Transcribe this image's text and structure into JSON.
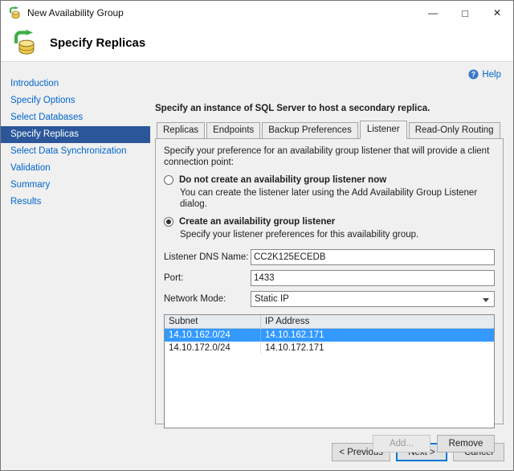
{
  "window": {
    "title": "New Availability Group",
    "controls": {
      "minimize": "—",
      "maximize": "□",
      "close": "✕"
    }
  },
  "header": {
    "title": "Specify Replicas"
  },
  "sidebar": {
    "items": [
      {
        "label": "Introduction",
        "selected": false
      },
      {
        "label": "Specify Options",
        "selected": false
      },
      {
        "label": "Select Databases",
        "selected": false
      },
      {
        "label": "Specify Replicas",
        "selected": true
      },
      {
        "label": "Select Data Synchronization",
        "selected": false
      },
      {
        "label": "Validation",
        "selected": false
      },
      {
        "label": "Summary",
        "selected": false
      },
      {
        "label": "Results",
        "selected": false
      }
    ]
  },
  "content": {
    "help_label": "Help",
    "instruction": "Specify an instance of SQL Server to host a secondary replica.",
    "tabs": [
      {
        "label": "Replicas",
        "selected": false
      },
      {
        "label": "Endpoints",
        "selected": false
      },
      {
        "label": "Backup Preferences",
        "selected": false
      },
      {
        "label": "Listener",
        "selected": true
      },
      {
        "label": "Read-Only Routing",
        "selected": false
      }
    ],
    "listener": {
      "intro": "Specify your preference for an availability group listener that will provide a client connection point:",
      "radio_no": {
        "label": "Do not create an availability group listener now",
        "desc": "You can create the listener later using the Add Availability Group Listener dialog.",
        "checked": false
      },
      "radio_yes": {
        "label": "Create an availability group listener",
        "desc": "Specify your listener preferences for this availability group.",
        "checked": true
      },
      "fields": {
        "dns_label": "Listener DNS Name:",
        "dns_value": "CC2K125ECEDB",
        "port_label": "Port:",
        "port_value": "1433",
        "network_mode_label": "Network Mode:",
        "network_mode_value": "Static IP"
      },
      "grid": {
        "columns": [
          "Subnet",
          "IP Address"
        ],
        "rows": [
          {
            "subnet": "14.10.162.0/24",
            "ip": "14.10.162.171",
            "selected": true
          },
          {
            "subnet": "14.10.172.0/24",
            "ip": "14.10.172.171",
            "selected": false
          }
        ]
      },
      "buttons": {
        "add": "Add...",
        "remove": "Remove"
      }
    }
  },
  "footer": {
    "previous": "< Previous",
    "next": "Next >",
    "cancel": "Cancel"
  },
  "colors": {
    "selected_step_bg": "#2b579a",
    "link": "#0066cc",
    "row_selected_bg": "#3399ff",
    "default_button_border": "#0078d7"
  }
}
